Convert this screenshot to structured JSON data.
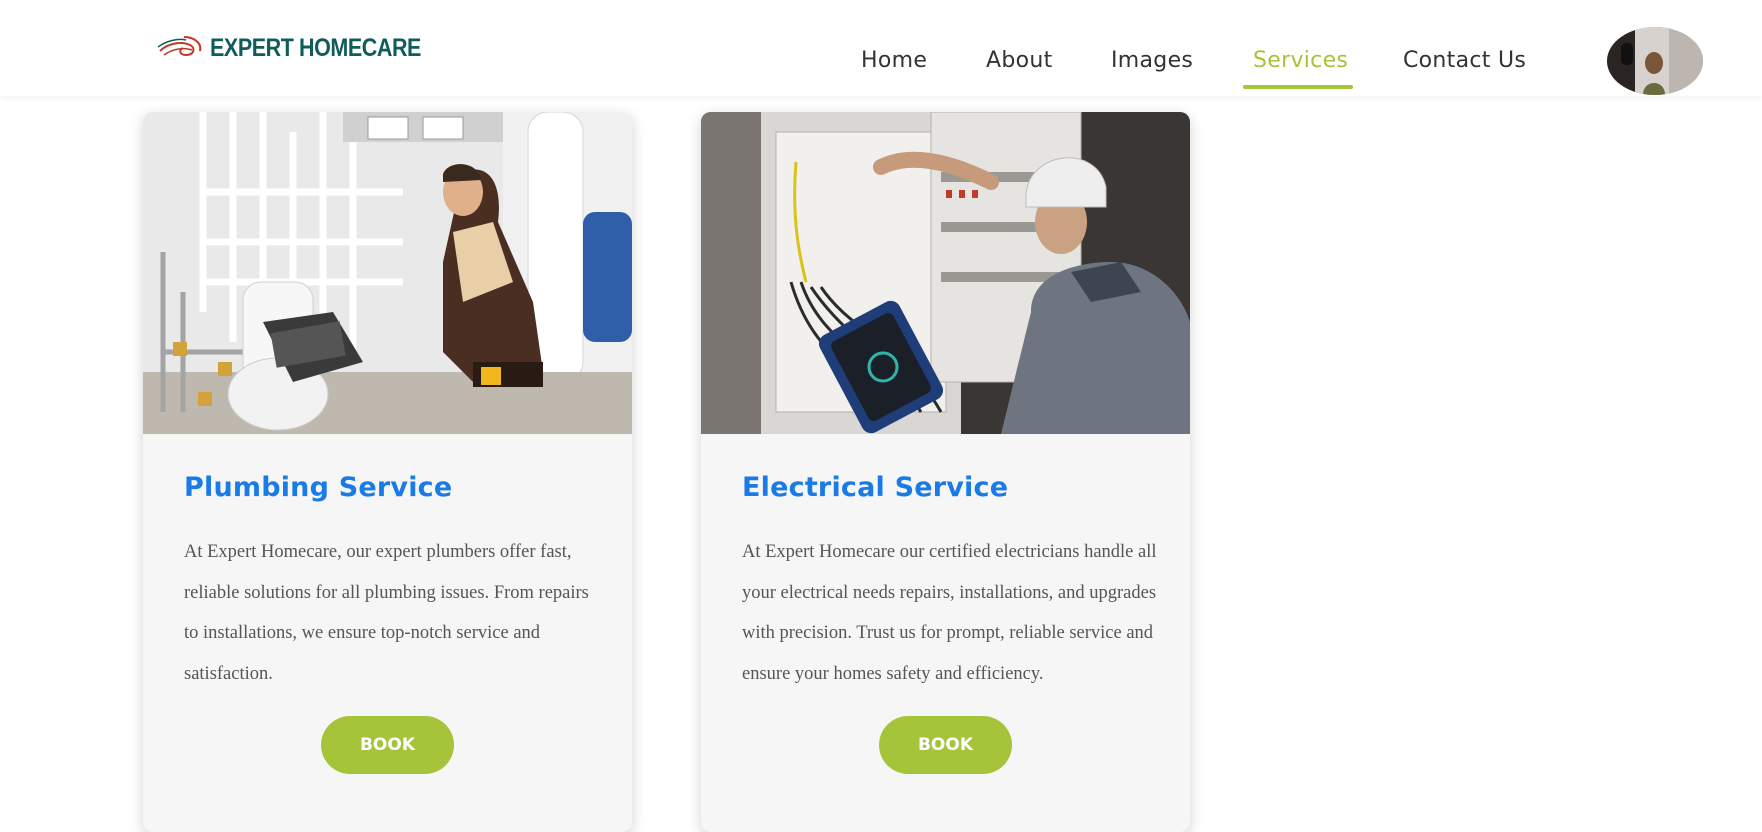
{
  "brand": {
    "name": "EXPERT HOMECARE",
    "color": "#0f5c5a",
    "logo_icon": "swirl-icon"
  },
  "nav": {
    "items": [
      {
        "label": "Home",
        "active": false
      },
      {
        "label": "About",
        "active": false
      },
      {
        "label": "Images",
        "active": false
      },
      {
        "label": "Services",
        "active": true
      },
      {
        "label": "Contact Us",
        "active": false
      }
    ],
    "accent": "#a6c43a"
  },
  "user": {
    "avatar": "user-avatar-photo"
  },
  "services": [
    {
      "image": "plumber-at-work-photo",
      "title": "Plumbing Service",
      "description": "At Expert Homecare, our expert plumbers offer fast, reliable solutions for all plumbing issues. From repairs to installations, we ensure top-notch service and satisfaction.",
      "button": "BOOK"
    },
    {
      "image": "electrician-at-panel-photo",
      "title": "Electrical Service",
      "description": "At Expert Homecare our certified electricians handle all your electrical needs repairs, installations, and upgrades with precision. Trust us for prompt, reliable service and ensure your homes safety and efficiency.",
      "button": "BOOK"
    }
  ],
  "colors": {
    "title": "#1a7ae6",
    "button": "#a6c43a",
    "card_bg": "#f6f6f6"
  }
}
